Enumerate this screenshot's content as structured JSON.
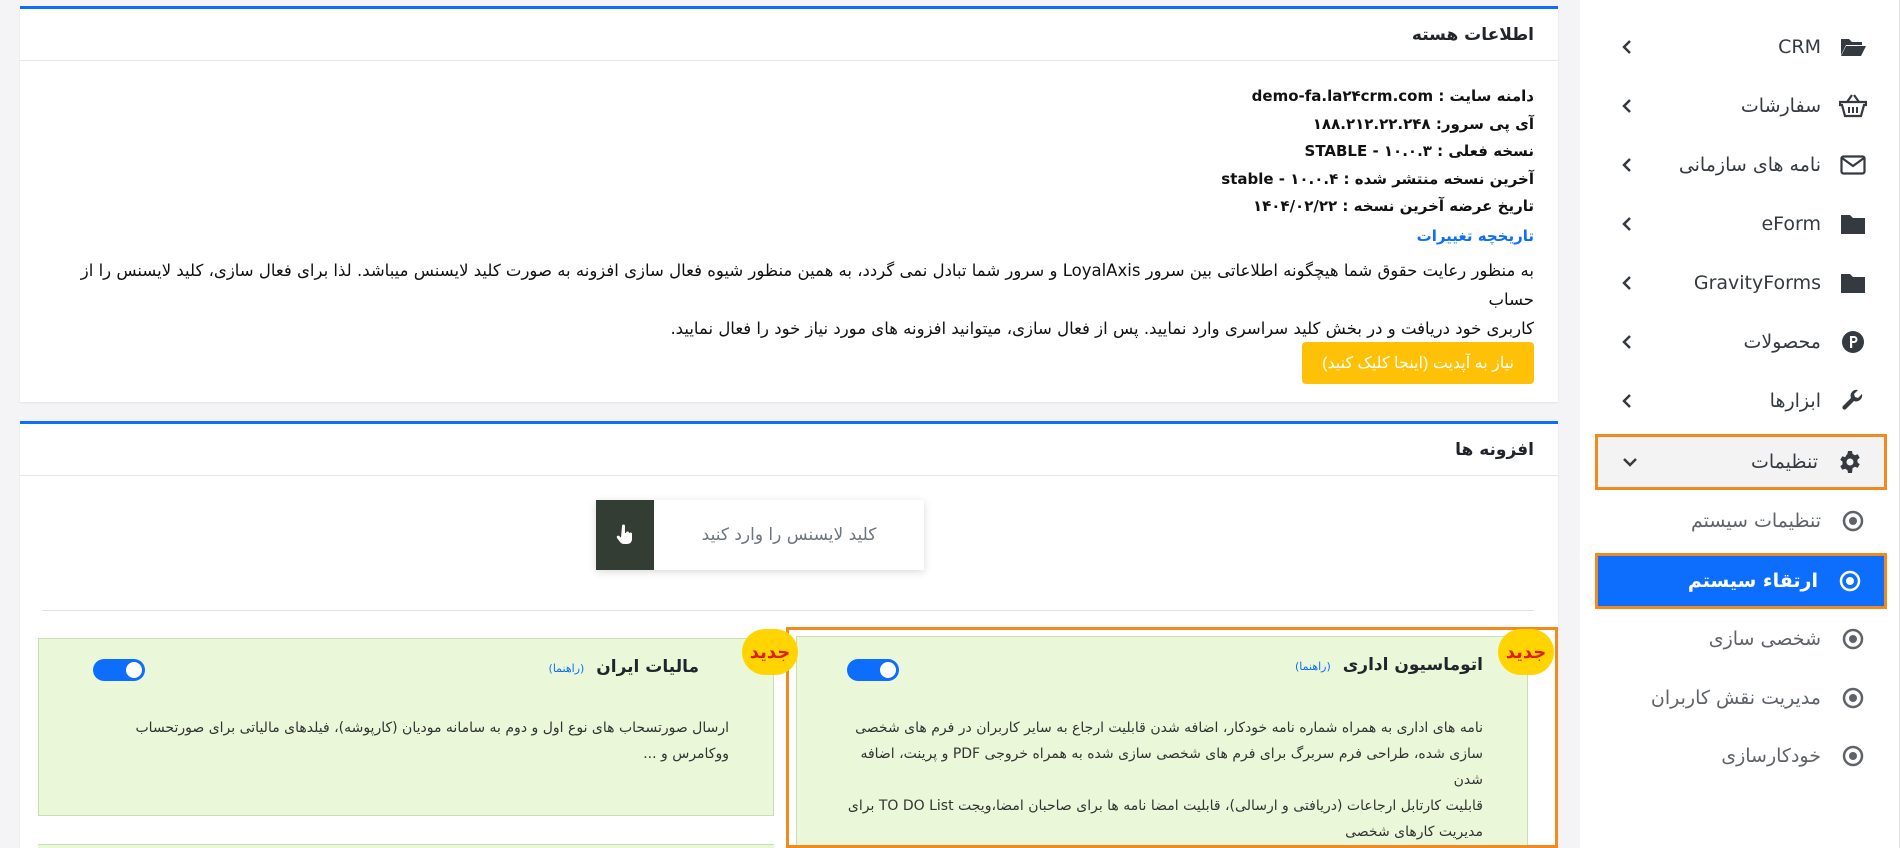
{
  "sidebar": {
    "items": [
      {
        "label": "CRM",
        "icon": "folder-open-icon"
      },
      {
        "label": "سفارشات",
        "icon": "basket-icon"
      },
      {
        "label": "نامه های سازمانی",
        "icon": "envelope-icon"
      },
      {
        "label": "eForm",
        "icon": "folder-icon"
      },
      {
        "label": "GravityForms",
        "icon": "folder-icon"
      },
      {
        "label": "محصولات",
        "icon": "product-p-icon"
      },
      {
        "label": "ابزارها",
        "icon": "wrench-icon"
      },
      {
        "label": "تنظیمات",
        "icon": "gear-icon"
      }
    ],
    "subitems": [
      {
        "label": "تنظیمات سیستم"
      },
      {
        "label": "ارتقاء سیستم"
      },
      {
        "label": "شخصی سازی"
      },
      {
        "label": "مدیریت نقش کاربران"
      },
      {
        "label": "خودکارسازی"
      }
    ]
  },
  "core": {
    "title": "اطلاعات هسته",
    "lines": [
      "دامنه سایت : demo-fa.la۲۴crm.com",
      "آی پی سرور: ۱۸۸.۲۱۲.۲۲.۲۴۸",
      "نسخه فعلی : ۱۰.۰.۳ - STABLE",
      "آخرین نسخه منتشر شده : ۱۰.۰.۴ - stable",
      "تاریخ عرضه آخرین نسخه : ۱۴۰۴/۰۲/۲۲"
    ],
    "changelog": "تاریخچه تغییرات",
    "paragraph_1": "به منظور رعایت حقوق شما هیچگونه اطلاعاتی بین سرور LoyalAxis و سرور شما تبادل نمی گردد، به همین منظور شیوه فعال سازی افزونه به صورت کلید لایسنس میباشد. لذا برای فعال سازی، کلید لایسنس را از حساب",
    "paragraph_2": "کاربری خود دریافت و در بخش کلید سراسری وارد نمایید. پس از فعال سازی، میتوانید افزونه های مورد نیاز خود را فعال نمایید.",
    "update_button": "نیاز به آپدیت (اینجا کلیک کنید)"
  },
  "addons": {
    "title": "افزونه ها",
    "license_placeholder": "کلید لایسنس را وارد کنید",
    "cards": [
      {
        "title": "اتوماسیون اداری",
        "guide": "(راهنما)",
        "badge": "جدید",
        "enabled": true,
        "desc_lines": [
          "نامه های اداری به همراه شماره نامه خودکار، اضافه شدن قابلیت ارجاع به سایر کاربران در فرم های شخصی",
          "سازی شده، طراحی فرم سربرگ برای فرم های شخصی سازی شده به همراه خروجی PDF و پرینت، اضافه شدن",
          "قابلیت کارتابل ارجاعات (دریافتی و ارسالی)، قابلیت امضا نامه ها برای صاحبان امضا،ویجت TO DO List برای",
          "مدیریت کارهای شخصی"
        ]
      },
      {
        "title": "مالیات ایران",
        "guide": "(راهنما)",
        "badge": "جدید",
        "enabled": true,
        "desc_lines": [
          "ارسال صورتسحاب های نوع اول و دوم به سامانه مودیان (کارپوشه)، فیلدهای مالیاتی برای صورتحساب",
          "ووکامرس و ..."
        ]
      }
    ]
  },
  "colors": {
    "primary": "#0d6efd",
    "warning": "#ffc107",
    "highlight": "#f28a1f",
    "addon_bg": "#eaf8d9",
    "badge_text": "#e11d1d"
  }
}
